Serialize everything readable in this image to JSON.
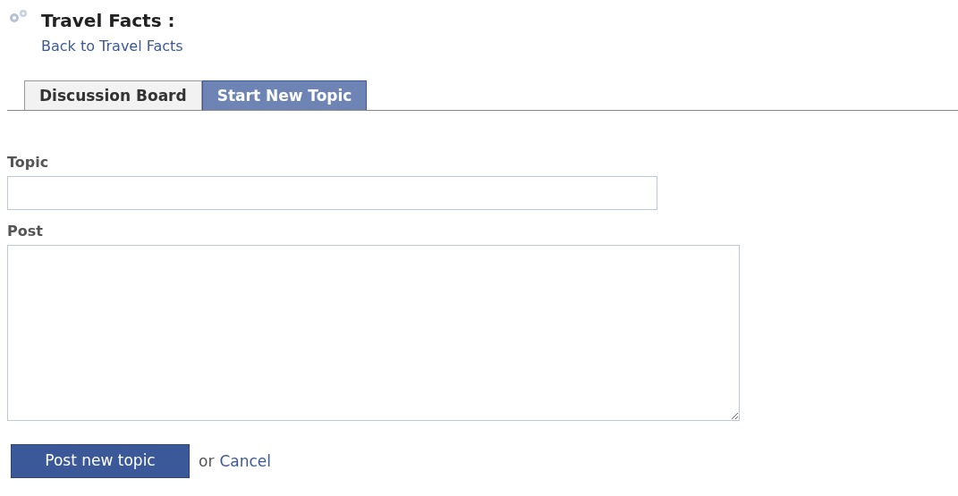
{
  "header": {
    "title": "Travel Facts :",
    "back_link": "Back to Travel Facts"
  },
  "tabs": [
    {
      "label": "Discussion Board",
      "selected": false
    },
    {
      "label": "Start New Topic",
      "selected": true
    }
  ],
  "form": {
    "topic_label": "Topic",
    "post_label": "Post"
  },
  "actions": {
    "submit": "Post new topic",
    "separator": "or",
    "cancel": "Cancel"
  }
}
